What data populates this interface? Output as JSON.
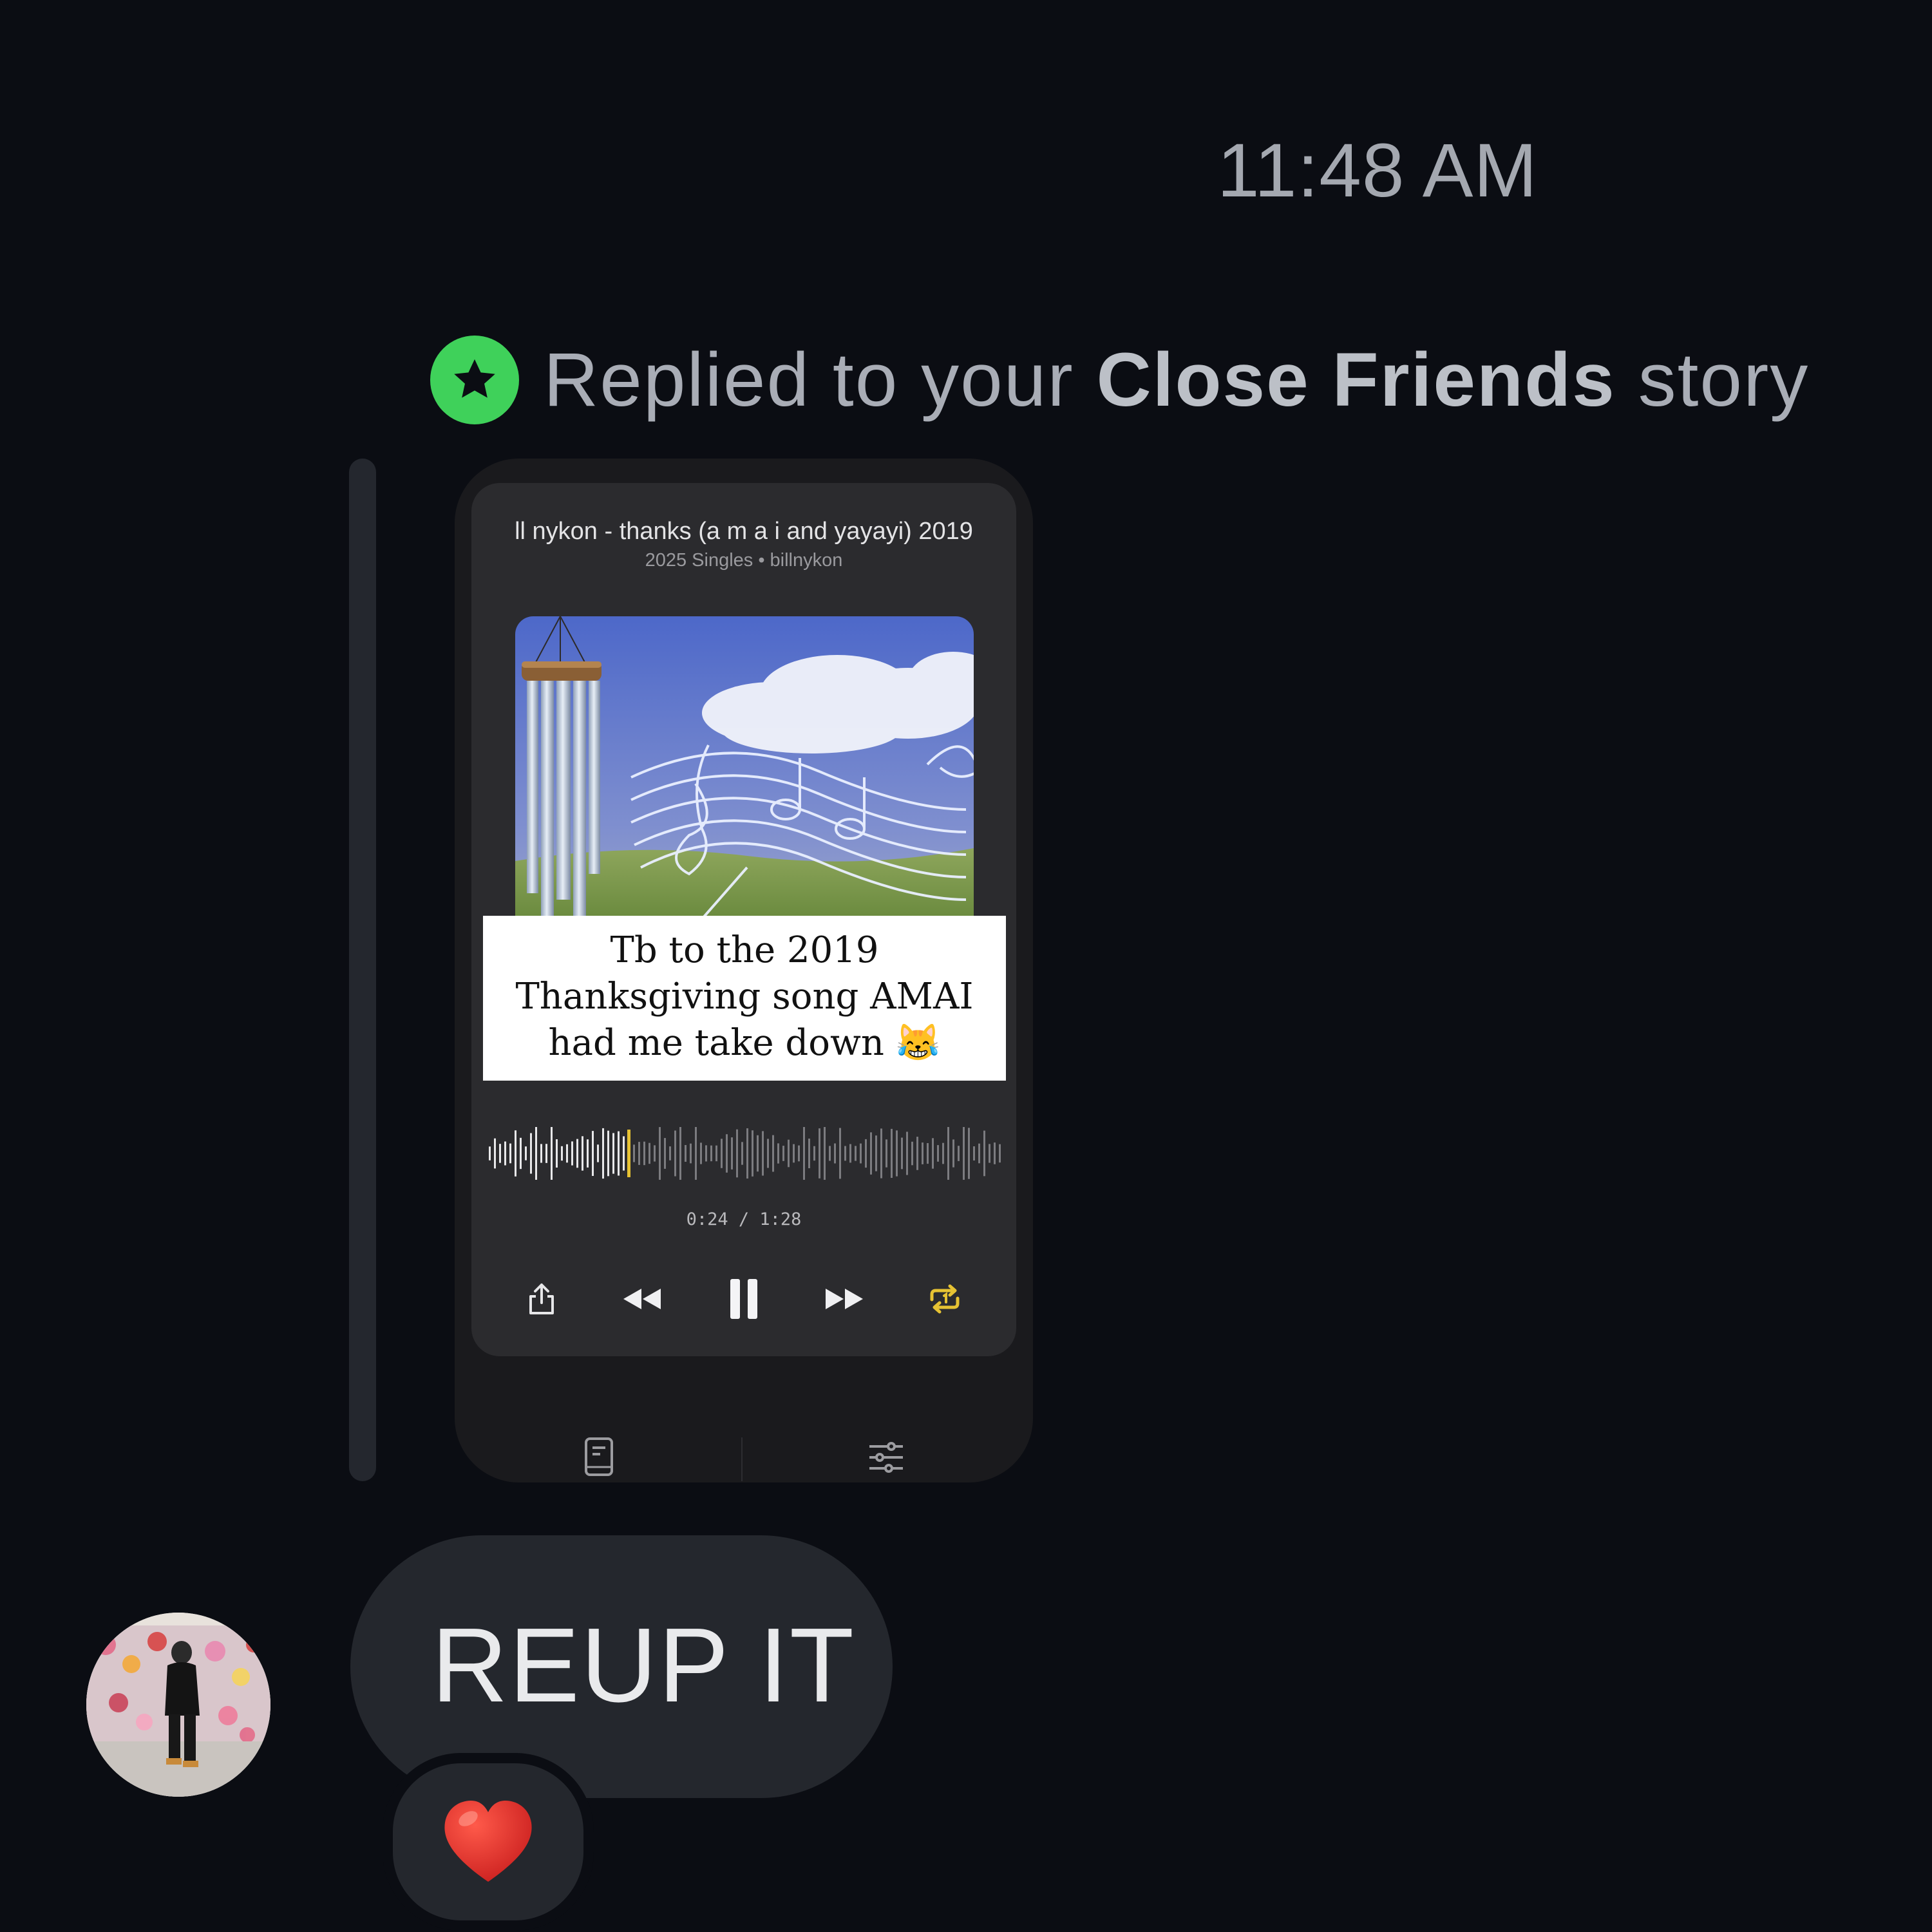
{
  "timestamp": "11:48 AM",
  "reply_header": {
    "prefix": "Replied to your ",
    "highlight": "Close Friends",
    "suffix": " story",
    "badge_icon": "star-icon",
    "badge_color": "#3fd15a"
  },
  "story": {
    "track_title": "ll nykon - thanks (a m a i and yayayi) 2019",
    "track_subtitle": "2025 Singles • billnykon",
    "caption": "Tb to the 2019 Thanksgiving song AMAI had me take down 😹",
    "time_readout": "0:24 / 1:28",
    "progress_fraction": 0.27,
    "accent_color": "#e6c233",
    "controls": [
      "share-icon",
      "rewind-icon",
      "pause-icon",
      "fast-forward-icon",
      "repeat-icon"
    ],
    "bottom_icons": [
      "lyrics-icon",
      "equalizer-icon"
    ]
  },
  "message": {
    "text": "REUP IT",
    "reaction": "❤️"
  }
}
